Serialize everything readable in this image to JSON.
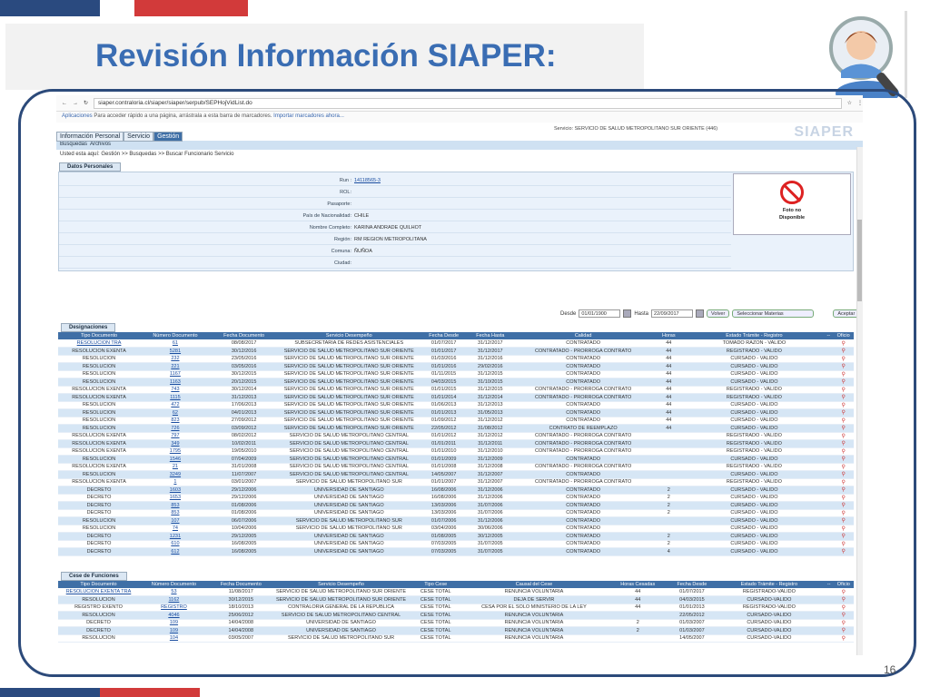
{
  "slide": {
    "title": "Revisión Información SIAPER:",
    "page_number": "16",
    "accent_colors": [
      "#2a4a7f",
      "#d23a3a",
      "#3a6db3"
    ]
  },
  "browser": {
    "url": "siaper.contraloria.cl/siaper/siaper/serpub/SEPHojVidList.do",
    "apps_label": "Aplicaciones",
    "bookmarks_hint": "Para acceder rápido a una página, arrástrala a esta barra de marcadores.",
    "import_link": "Importar marcadores ahora..."
  },
  "app": {
    "logo": "SIAPER",
    "service_text": "Servicio: SERVICIO DE SALUD METROPOLITANO SUR ORIENTE (446)",
    "tabs": [
      "Información Personal",
      "Servicio",
      "Gestión"
    ],
    "menu": [
      "Busquedas",
      "Archivos"
    ],
    "breadcrumb": "Usted esta aquí: Gestión >> Busquedas >> Buscar Funcionario Servicio"
  },
  "datos_personales": {
    "section_label": "Datos Personales",
    "fields": [
      {
        "label": "Run :",
        "value": "14118565-3",
        "link": true
      },
      {
        "label": "ROL:",
        "value": ""
      },
      {
        "label": "Pasaporte:",
        "value": ""
      },
      {
        "label": "País de Nacionalidad:",
        "value": "CHILE"
      },
      {
        "label": "Nombre Completo:",
        "value": "KARINA ANDRADE QUILHOT"
      },
      {
        "label": "Región:",
        "value": "RM REGION METROPOLITANA"
      },
      {
        "label": "Comuna:",
        "value": "ÑUÑOA"
      },
      {
        "label": "Ciudad:",
        "value": ""
      }
    ],
    "photo_text_1": "Foto no",
    "photo_text_2": "Disponible"
  },
  "filter": {
    "desde_label": "Desde",
    "desde_value": "01/01/1900",
    "hasta_label": "Hasta",
    "hasta_value": "22/09/2017",
    "volver": "Volver",
    "seleccionar": "Seleccionar Materias",
    "aceptar": "Aceptar"
  },
  "designaciones": {
    "section_label": "Designaciones",
    "headers": [
      "Tipo Documento",
      "Número Documento",
      "Fecha Documento",
      "Servicio Desempeño",
      "Fecha Desde",
      "Fecha Hasta",
      "Calidad",
      "Horas",
      "Estado Trámite - Registro",
      "--",
      "Oficio"
    ],
    "rows": [
      [
        "RESOLUCION TRA",
        "61",
        "08/08/2017",
        "SUBSECRETARIA DE REDES ASISTENCIALES",
        "01/07/2017",
        "31/12/2017",
        "CONTRATADO",
        "44",
        "TOMADO RAZON - VALIDO"
      ],
      [
        "RESOLUCION EXENTA",
        "5281",
        "30/12/2016",
        "SERVICIO DE SALUD METROPOLITANO SUR ORIENTE",
        "01/01/2017",
        "31/12/2017",
        "CONTRATADO - PRORROGA CONTRATO",
        "44",
        "REGISTRADO - VALIDO"
      ],
      [
        "RESOLUCION",
        "232",
        "23/05/2016",
        "SERVICIO DE SALUD METROPOLITANO SUR ORIENTE",
        "01/03/2016",
        "31/12/2016",
        "CONTRATADO",
        "44",
        "CURSADO - VALIDO"
      ],
      [
        "RESOLUCION",
        "221",
        "03/05/2016",
        "SERVICIO DE SALUD METROPOLITANO SUR ORIENTE",
        "01/01/2016",
        "29/02/2016",
        "CONTRATADO",
        "44",
        "CURSADO - VALIDO"
      ],
      [
        "RESOLUCION",
        "1167",
        "30/12/2015",
        "SERVICIO DE SALUD METROPOLITANO SUR ORIENTE",
        "01/11/2015",
        "31/12/2015",
        "CONTRATADO",
        "44",
        "CURSADO - VALIDO"
      ],
      [
        "RESOLUCION",
        "1163",
        "20/12/2015",
        "SERVICIO DE SALUD METROPOLITANO SUR ORIENTE",
        "04/03/2015",
        "31/10/2015",
        "CONTRATADO",
        "44",
        "CURSADO - VALIDO"
      ],
      [
        "RESOLUCION EXENTA",
        "743",
        "30/12/2014",
        "SERVICIO DE SALUD METROPOLITANO SUR ORIENTE",
        "01/01/2015",
        "31/12/2015",
        "CONTRATADO - PRORROGA CONTRATO",
        "44",
        "REGISTRADO - VALIDO"
      ],
      [
        "RESOLUCION EXENTA",
        "1115",
        "31/12/2013",
        "SERVICIO DE SALUD METROPOLITANO SUR ORIENTE",
        "01/01/2014",
        "31/12/2014",
        "CONTRATADO - PRORROGA CONTRATO",
        "44",
        "REGISTRADO - VALIDO"
      ],
      [
        "RESOLUCION",
        "472",
        "17/06/2013",
        "SERVICIO DE SALUD METROPOLITANO SUR ORIENTE",
        "01/06/2013",
        "31/12/2013",
        "CONTRATADO",
        "44",
        "CURSADO - VALIDO"
      ],
      [
        "RESOLUCION",
        "62",
        "04/01/2013",
        "SERVICIO DE SALUD METROPOLITANO SUR ORIENTE",
        "01/01/2013",
        "31/05/2013",
        "CONTRATADO",
        "44",
        "CURSADO - VALIDO"
      ],
      [
        "RESOLUCION",
        "823",
        "27/09/2012",
        "SERVICIO DE SALUD METROPOLITANO SUR ORIENTE",
        "01/09/2012",
        "31/12/2012",
        "CONTRATADO",
        "44",
        "CURSADO - VALIDO"
      ],
      [
        "RESOLUCION",
        "726",
        "03/09/2012",
        "SERVICIO DE SALUD METROPOLITANO SUR ORIENTE",
        "22/05/2012",
        "31/08/2012",
        "CONTRATO DE REEMPLAZO",
        "44",
        "CURSADO - VALIDO"
      ],
      [
        "RESOLUCION EXENTA",
        "797",
        "08/02/2012",
        "SERVICIO DE SALUD METROPOLITANO CENTRAL",
        "01/01/2012",
        "31/12/2012",
        "CONTRATADO - PRORROGA CONTRATO",
        "",
        "REGISTRADO - VALIDO"
      ],
      [
        "RESOLUCION EXENTA",
        "349",
        "10/02/2011",
        "SERVICIO DE SALUD METROPOLITANO CENTRAL",
        "01/01/2011",
        "31/12/2011",
        "CONTRATADO - PRORROGA CONTRATO",
        "",
        "REGISTRADO - VALIDO"
      ],
      [
        "RESOLUCION EXENTA",
        "1795",
        "19/05/2010",
        "SERVICIO DE SALUD METROPOLITANO CENTRAL",
        "01/01/2010",
        "31/12/2010",
        "CONTRATADO - PRORROGA CONTRATO",
        "",
        "REGISTRADO - VALIDO"
      ],
      [
        "RESOLUCION",
        "1546",
        "07/04/2009",
        "SERVICIO DE SALUD METROPOLITANO CENTRAL",
        "01/01/2009",
        "31/12/2009",
        "CONTRATADO",
        "",
        "CURSADO - VALIDO"
      ],
      [
        "RESOLUCION EXENTA",
        "21",
        "31/01/2008",
        "SERVICIO DE SALUD METROPOLITANO CENTRAL",
        "01/01/2008",
        "31/12/2008",
        "CONTRATADO - PRORROGA CONTRATO",
        "",
        "REGISTRADO - VALIDO"
      ],
      [
        "RESOLUCION",
        "3249",
        "11/07/2007",
        "SERVICIO DE SALUD METROPOLITANO CENTRAL",
        "14/05/2007",
        "31/12/2007",
        "CONTRATADO",
        "",
        "CURSADO - VALIDO"
      ],
      [
        "RESOLUCION EXENTA",
        "1",
        "03/01/2007",
        "SERVICIO DE SALUD METROPOLITANO SUR",
        "01/01/2007",
        "31/12/2007",
        "CONTRATADO - PRORROGA CONTRATO",
        "",
        "REGISTRADO - VALIDO"
      ],
      [
        "DECRETO",
        "1603",
        "29/12/2006",
        "UNIVERSIDAD DE SANTIAGO",
        "16/08/2006",
        "31/12/2006",
        "CONTRATADO",
        "2",
        "CURSADO - VALIDO"
      ],
      [
        "DECRETO",
        "1653",
        "29/12/2006",
        "UNIVERSIDAD DE SANTIAGO",
        "16/08/2006",
        "31/12/2006",
        "CONTRATADO",
        "2",
        "CURSADO - VALIDO"
      ],
      [
        "DECRETO",
        "853",
        "01/08/2006",
        "UNIVERSIDAD DE SANTIAGO",
        "13/03/2006",
        "31/07/2006",
        "CONTRATADO",
        "2",
        "CURSADO - VALIDO"
      ],
      [
        "DECRETO",
        "853",
        "01/08/2006",
        "UNIVERSIDAD DE SANTIAGO",
        "13/03/2006",
        "31/07/2006",
        "CONTRATADO",
        "2",
        "CURSADO - VALIDO"
      ],
      [
        "RESOLUCION",
        "107",
        "06/07/2006",
        "SERVICIO DE SALUD METROPOLITANO SUR",
        "01/07/2006",
        "31/12/2006",
        "CONTRATADO",
        "",
        "CURSADO - VALIDO"
      ],
      [
        "RESOLUCION",
        "74",
        "10/04/2006",
        "SERVICIO DE SALUD METROPOLITANO SUR",
        "03/04/2006",
        "30/06/2006",
        "CONTRATADO",
        "",
        "CURSADO - VALIDO"
      ],
      [
        "DECRETO",
        "1231",
        "29/12/2005",
        "UNIVERSIDAD DE SANTIAGO",
        "01/08/2005",
        "30/12/2005",
        "CONTRATADO",
        "2",
        "CURSADO - VALIDO"
      ],
      [
        "DECRETO",
        "610",
        "16/08/2005",
        "UNIVERSIDAD DE SANTIAGO",
        "07/03/2005",
        "31/07/2005",
        "CONTRATADO",
        "2",
        "CURSADO - VALIDO"
      ],
      [
        "DECRETO",
        "612",
        "16/08/2005",
        "UNIVERSIDAD DE SANTIAGO",
        "07/03/2005",
        "31/07/2005",
        "CONTRATADO",
        "4",
        "CURSADO - VALIDO"
      ]
    ]
  },
  "cese": {
    "section_label": "Cese de Funciones",
    "headers": [
      "Tipo Documento",
      "Número Documento",
      "Fecha Documento",
      "Servicio Desempeño",
      "Tipo Cese",
      "Causal del Cese",
      "Horas Cesadas",
      "Fecha Desde",
      "Estado Trámite - Registro",
      "--",
      "Oficio"
    ],
    "rows": [
      [
        "RESOLUCION EXENTA TRA",
        "53",
        "11/08/2017",
        "SERVICIO DE SALUD METROPOLITANO SUR ORIENTE",
        "CESE TOTAL",
        "RENUNCIA VOLUNTARIA",
        "44",
        "01/07/2017",
        "REGISTRADO-VALIDO"
      ],
      [
        "RESOLUCION",
        "1162",
        "30/12/2015",
        "SERVICIO DE SALUD METROPOLITANO SUR ORIENTE",
        "CESE TOTAL",
        "DEJA DE SERVIR",
        "44",
        "04/03/2015",
        "CURSADO-VALIDO"
      ],
      [
        "REGISTRO EXENTO",
        "REGISTRO",
        "18/10/2013",
        "CONTRALORIA GENERAL DE LA REPUBLICA",
        "CESE TOTAL",
        "CESA POR EL SOLO MINISTERIO DE LA LEY",
        "44",
        "01/01/2013",
        "REGISTRADO-VALIDO"
      ],
      [
        "RESOLUCION",
        "4046",
        "25/06/2012",
        "SERVICIO DE SALUD METROPOLITANO CENTRAL",
        "CESE TOTAL",
        "RENUNCIA VOLUNTARIA",
        "",
        "22/05/2012",
        "CURSADO-VALIDO"
      ],
      [
        "DECRETO",
        "109",
        "14/04/2008",
        "UNIVERSIDAD DE SANTIAGO",
        "CESE TOTAL",
        "RENUNCIA VOLUNTARIA",
        "2",
        "01/03/2007",
        "CURSADO-VALIDO"
      ],
      [
        "DECRETO",
        "109",
        "14/04/2008",
        "UNIVERSIDAD DE SANTIAGO",
        "CESE TOTAL",
        "RENUNCIA VOLUNTARIA",
        "2",
        "01/03/2007",
        "CURSADO-VALIDO"
      ],
      [
        "RESOLUCION",
        "104",
        "03/05/2007",
        "SERVICIO DE SALUD METROPOLITANO SUR",
        "CESE TOTAL",
        "RENUNCIA VOLUNTARIA",
        "",
        "14/05/2007",
        "CURSADO-VALIDO"
      ]
    ]
  }
}
